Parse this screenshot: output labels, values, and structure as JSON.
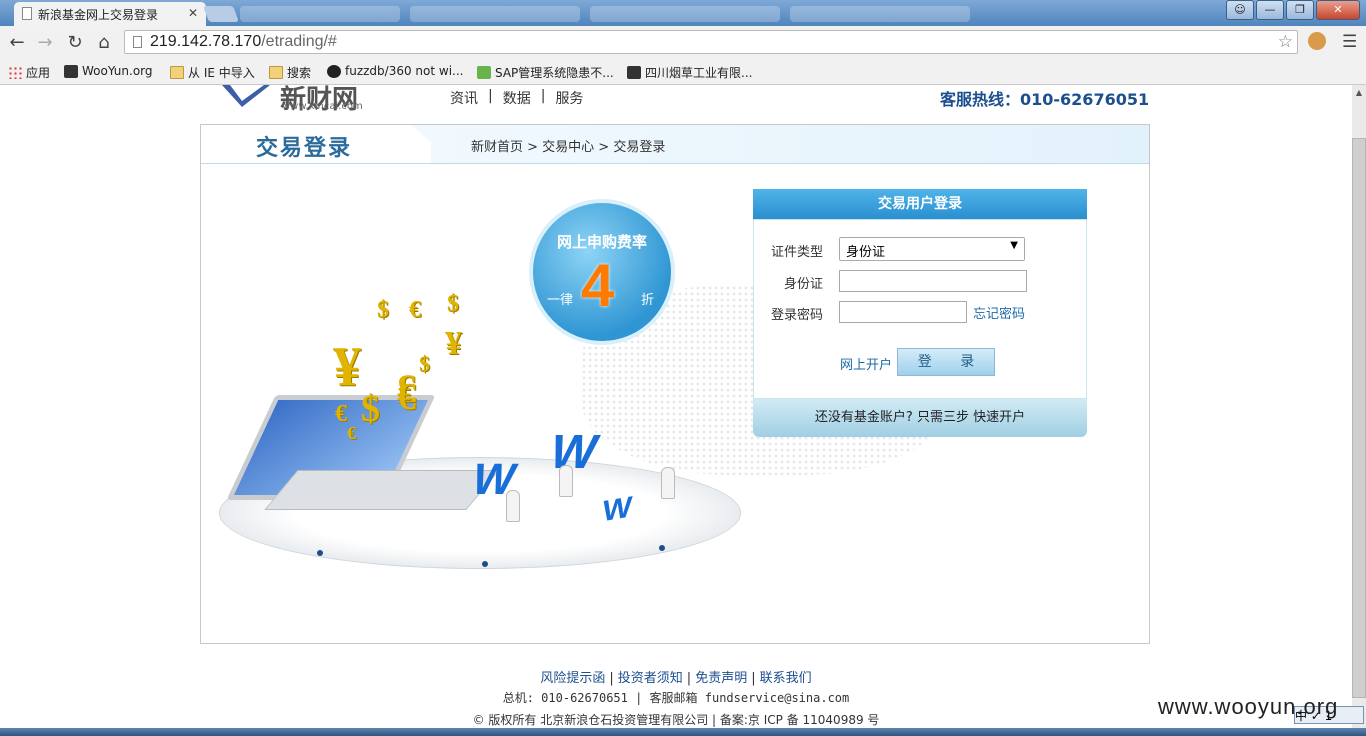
{
  "browser": {
    "tab_title": "新浪基金网上交易登录",
    "tab_close": "✕",
    "url_host": "219.142.78.170",
    "url_path": "/etrading/#",
    "bookmarks": [
      {
        "label": "应用",
        "icon": "apps-icon"
      },
      {
        "label": "WooYun.org",
        "icon": "wooyun-icon"
      },
      {
        "label": "从 IE 中导入",
        "icon": "folder-icon"
      },
      {
        "label": "搜索",
        "icon": "folder-icon"
      },
      {
        "label": "fuzzdb/360 not wi...",
        "icon": "github-icon"
      },
      {
        "label": "SAP管理系统隐患不...",
        "icon": "sap-icon"
      },
      {
        "label": "四川烟草工业有限...",
        "icon": "wooyun-icon"
      }
    ]
  },
  "site": {
    "logo_text": "新财网",
    "logo_sub": "www.xincai.com",
    "nav": [
      "资讯",
      "数据",
      "服务"
    ],
    "nav_sep": "|",
    "hotline": "客服热线：010-62676051",
    "page_heading": "交易登录",
    "breadcrumb": "新财首页 > 交易中心 > 交易登录"
  },
  "promo": {
    "line1": "网上申购费率",
    "number": "4",
    "left": "一律",
    "right": "折"
  },
  "login": {
    "title": "交易用户登录",
    "id_type_label": "证件类型",
    "id_type_value": "身份证",
    "id_label": "身份证",
    "password_label": "登录密码",
    "forgot": "忘记密码",
    "open_account": "网上开户",
    "submit": "登 录",
    "footer": "还没有基金账户? 只需三步 快速开户"
  },
  "footer": {
    "links": [
      "风险提示函",
      "投资者须知",
      "免责声明",
      "联系我们"
    ],
    "link_sep": "|",
    "contact": "总机: 010-62670651  |  客服邮箱 fundservice@sina.com",
    "copyright": "© 版权所有  北京新浪仓石投资管理有限公司  |  备案:京 ICP 备 11040989 号"
  },
  "watermark": "www.wooyun.org",
  "ime": "中 ✓ 1"
}
